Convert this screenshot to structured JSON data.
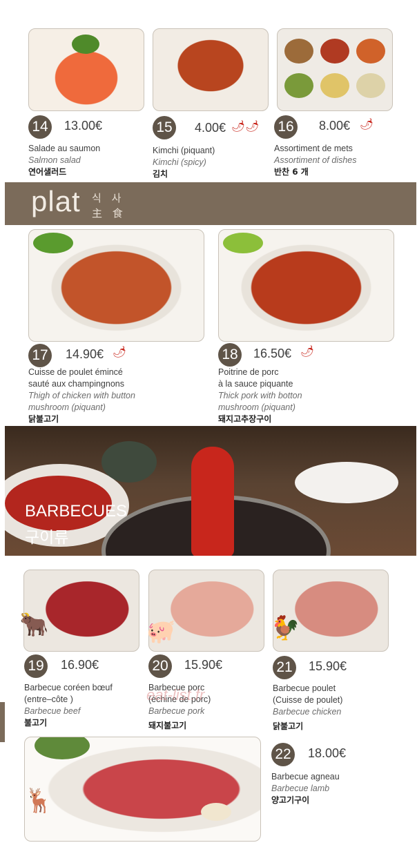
{
  "top_items": [
    {
      "num": "14",
      "price": "13.00€",
      "chili": "",
      "fr": [
        "Salade au saumon"
      ],
      "en": [
        "Salmon salad"
      ],
      "ko": "연어샐러드"
    },
    {
      "num": "15",
      "price": "4.00€",
      "chili": "🌶🌶",
      "fr": [
        "Kimchi (piquant)"
      ],
      "en": [
        "Kimchi (spicy)"
      ],
      "ko": "김치"
    },
    {
      "num": "16",
      "price": "8.00€",
      "chili": "🌶",
      "fr": [
        "Assortiment de mets"
      ],
      "en": [
        "Assortiment of dishes"
      ],
      "ko": "반찬 6 개"
    }
  ],
  "plat_banner": {
    "title": "plat",
    "kr": "식 사",
    "cn": "主 食"
  },
  "plat_items": [
    {
      "num": "17",
      "price": "14.90€",
      "chili": "🌶",
      "fr": [
        "Cuisse de poulet émincé",
        "sauté aux champingnons"
      ],
      "en": [
        "Thigh of chicken with button",
        "mushroom (piquant)"
      ],
      "ko": "닭불고기"
    },
    {
      "num": "18",
      "price": "16.50€",
      "chili": "🌶",
      "fr": [
        "Poitrine de porc",
        "à la sauce piquante"
      ],
      "en": [
        "Thick pork with botton",
        "mushroom (piquant)"
      ],
      "ko": "돼지고추장구이"
    }
  ],
  "bbq_banner": {
    "title": "BARBECUES",
    "ko": "구이류"
  },
  "bbq_items": [
    {
      "num": "19",
      "price": "16.90€",
      "animal": "cow-icon",
      "fr": [
        "Barbecue coréen bœuf",
        "(entre–côte )"
      ],
      "en": [
        "Barbecue beef"
      ],
      "ko": "불고기"
    },
    {
      "num": "20",
      "price": "15.90€",
      "animal": "pig-icon",
      "fr": [
        "Barbecue porc",
        "(échine de porc)"
      ],
      "en": [
        "Barbecue pork"
      ],
      "ko": "돼지불고기"
    },
    {
      "num": "21",
      "price": "15.90€",
      "animal": "chicken-icon",
      "fr": [
        "Barbecue poulet",
        "(Cuisse de poulet)"
      ],
      "en": [
        "Barbecue chicken"
      ],
      "ko": "닭불고기"
    },
    {
      "num": "22",
      "price": "18.00€",
      "animal": "deer-icon",
      "fr": [
        "Barbecue agneau"
      ],
      "en": [
        "Barbecue lamb"
      ],
      "ko": "양고기구이"
    }
  ],
  "watermark": "eat-list.fr",
  "colors": {
    "banner": "#7b6b5a",
    "badge": "#5f5448",
    "chili": "#c8251b",
    "animal": "#e07d22"
  }
}
